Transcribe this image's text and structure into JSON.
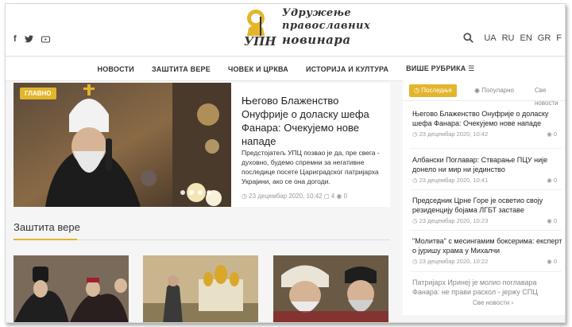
{
  "header": {
    "logo_lines": [
      "Удружење",
      "православних",
      "новинара"
    ],
    "logo_abbr": "УПН",
    "languages": [
      "UA",
      "RU",
      "EN",
      "GR",
      "F"
    ]
  },
  "nav": {
    "items": [
      "НОВОСТИ",
      "ЗАШТИТА ВЕРЕ",
      "ЧОВЕК И ЦРКВА",
      "ИСТОРИЈА И КУЛТУРА",
      "ВИШЕ РУБРИКА ☰"
    ]
  },
  "featured": {
    "badge": "ГЛАВНО",
    "title": "Његово Блаженство Онуфрије о доласку шефа Фанара: Очекујемо нове нападе",
    "text": "Предстојатељ УПЦ позвао је да, пре свега - духовно, будемо спремни за негативне последице посете Цариградског патријарха Украјини, ако се она догоди.",
    "date": "23 децембар 2020, 10:42",
    "comments": "4",
    "views": "0"
  },
  "section": {
    "title": "Заштита вере"
  },
  "sidebar": {
    "tabs": [
      "Последње",
      "Популарно",
      "Све новости"
    ],
    "items": [
      {
        "title": "Његово Блаженство Онуфрије о доласку шефа Фанара: Очекујемо нове нападе",
        "date": "23 децембар 2020, 10:42",
        "views": "0"
      },
      {
        "title": "Албански Поглавар: Стварање ПЦУ није донело ни мир ни јединство",
        "date": "23 децембар 2020, 10:41",
        "views": "0"
      },
      {
        "title": "Председник Црне Горе је осветио своју резиденцију бојама ЛГБТ заставе",
        "date": "23 децембар 2020, 10:23",
        "views": "0"
      },
      {
        "title": "\"Молитва\" с месингамим боксерима: експерт о јуришу храма у Михалчи",
        "date": "23 децембар 2020, 10:22",
        "views": "0"
      },
      {
        "title": "Патријарх Иринеј је молио поглавара Фанара: не прави раскол - јержу СПЦ",
        "date": "",
        "views": ""
      }
    ],
    "all_news": "Све новости ›"
  },
  "colors": {
    "accent": "#e2b52c"
  }
}
